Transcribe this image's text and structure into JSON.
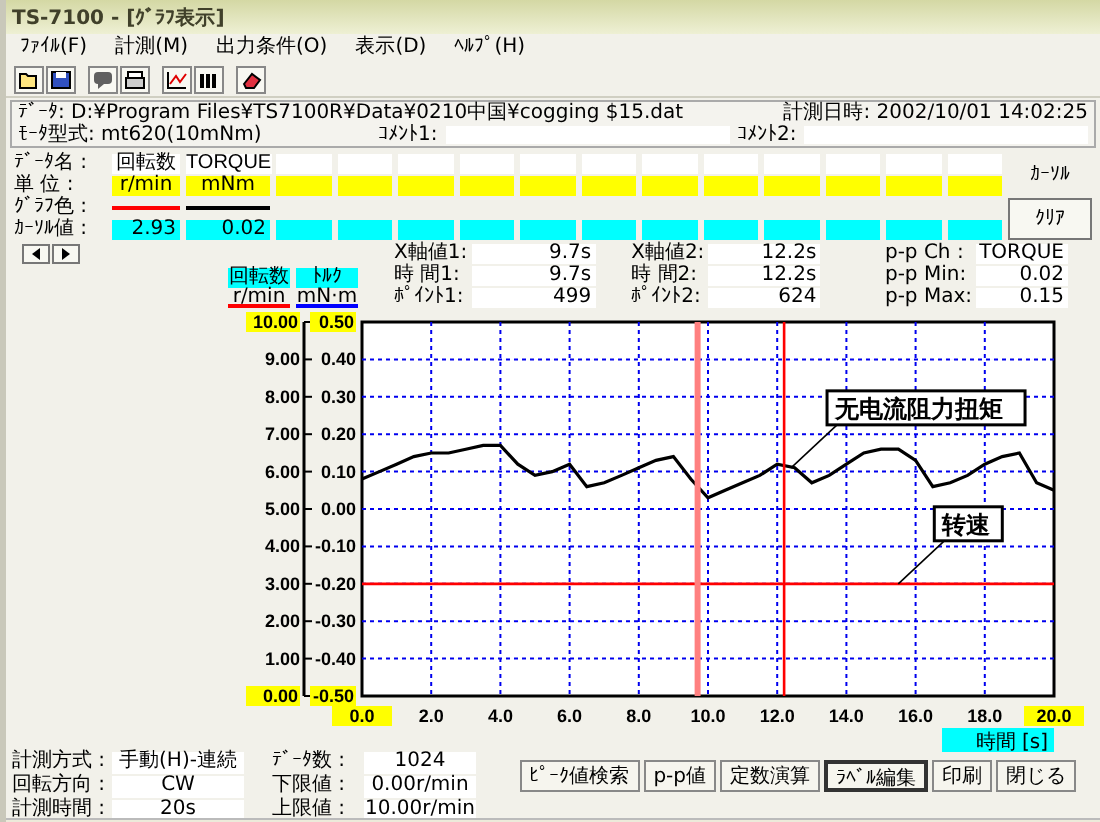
{
  "window": {
    "title": "TS-7100 - [ｸﾞﾗﾌ表示]"
  },
  "menu": [
    "ﾌｧｲﾙ(F)",
    "計測(M)",
    "出力条件(O)",
    "表示(D)",
    "ﾍﾙﾌﾟ(H)"
  ],
  "file_info": {
    "data_path": "ﾃﾞｰﾀ: D:¥Program Files¥TS7100R¥Data¥0210中国¥cogging $15.dat",
    "measured_at": "計測日時: 2002/10/01 14:02:25",
    "motor_type": "ﾓｰﾀ型式: mt620(10mNm)",
    "comment1_label": "ｺﾒﾝﾄ1:",
    "comment2_label": "ｺﾒﾝﾄ2:"
  },
  "channel_table": {
    "row_labels": [
      "ﾃﾞｰﾀ名 :",
      "単 位 :",
      "ｸﾞﾗﾌ色 :",
      "ｶｰｿﾙ値 :"
    ],
    "channels": [
      {
        "name": "回転数",
        "unit": "r/min",
        "color": "#ff0000",
        "cursor_value": "2.93"
      },
      {
        "name": "TORQUE",
        "unit": "mNm",
        "color": "#000000",
        "cursor_value": "0.02"
      }
    ],
    "cursor_label": "ｶｰｿﾙ",
    "clear_button": "ｸﾘｱ"
  },
  "cursor_info": {
    "cursor1": [
      {
        "label": "X軸値1:",
        "value": "9.7s"
      },
      {
        "label": "時 間1:",
        "value": "9.7s"
      },
      {
        "label": "ﾎﾟｲﾝﾄ1:",
        "value": "499"
      }
    ],
    "cursor2": [
      {
        "label": "X軸値2:",
        "value": "12.2s"
      },
      {
        "label": "時 間2:",
        "value": "12.2s"
      },
      {
        "label": "ﾎﾟｲﾝﾄ2:",
        "value": "624"
      }
    ],
    "peak_to_peak": [
      {
        "label": "p-p Ch :",
        "value": "TORQUE"
      },
      {
        "label": "p-p Min:",
        "value": "0.02"
      },
      {
        "label": "p-p Max:",
        "value": "0.15"
      }
    ]
  },
  "graph": {
    "axis_headers": [
      {
        "unit": "r/min",
        "color": "#ff0000"
      },
      {
        "unit": "mN·m",
        "color": "#0000ff"
      }
    ],
    "chart_data": {
      "type": "line",
      "xlabel": "時間 [s]",
      "grid": true,
      "ref_lines": [
        {
          "axis": "x",
          "value": 9.7,
          "color": "#ff8080"
        },
        {
          "axis": "x",
          "value": 12.2,
          "color": "#ff0000"
        }
      ],
      "xlim": [
        0,
        20
      ],
      "ylim": [
        0,
        10
      ],
      "y2lim": [
        -0.5,
        0.5
      ],
      "xticks": [
        {
          "value": 0,
          "label": "0.0"
        },
        {
          "value": 2,
          "label": "2.0"
        },
        {
          "value": 4,
          "label": "4.0"
        },
        {
          "value": 6,
          "label": "6.0"
        },
        {
          "value": 8,
          "label": "8.0"
        },
        {
          "value": 10,
          "label": "10.0"
        },
        {
          "value": 12,
          "label": "12.0"
        },
        {
          "value": 14,
          "label": "14.0"
        },
        {
          "value": 16,
          "label": "16.0"
        },
        {
          "value": 18,
          "label": "18.0"
        },
        {
          "value": 20,
          "label": "20.0"
        }
      ],
      "yticks": [
        {
          "value": 10,
          "label": "10.00"
        },
        {
          "value": 9,
          "label": "9.00"
        },
        {
          "value": 8,
          "label": "8.00"
        },
        {
          "value": 7,
          "label": "7.00"
        },
        {
          "value": 6,
          "label": "6.00"
        },
        {
          "value": 5,
          "label": "5.00"
        },
        {
          "value": 4,
          "label": "4.00"
        },
        {
          "value": 3,
          "label": "3.00"
        },
        {
          "value": 2,
          "label": "2.00"
        },
        {
          "value": 1,
          "label": "1.00"
        },
        {
          "value": 0,
          "label": "0.00"
        }
      ],
      "y2ticks": [
        {
          "value": 0.5,
          "label": "0.50"
        },
        {
          "value": 0.4,
          "label": "0.40"
        },
        {
          "value": 0.3,
          "label": "0.30"
        },
        {
          "value": 0.2,
          "label": "0.20"
        },
        {
          "value": 0.1,
          "label": "0.10"
        },
        {
          "value": 0,
          "label": "0.00"
        },
        {
          "value": -0.1,
          "label": "-0.10"
        },
        {
          "value": -0.2,
          "label": "-0.20"
        },
        {
          "value": -0.3,
          "label": "-0.30"
        },
        {
          "value": -0.4,
          "label": "-0.40"
        },
        {
          "value": -0.5,
          "label": "-0.50"
        }
      ],
      "x": [
        0,
        0.5,
        1,
        1.5,
        2,
        2.5,
        3,
        3.5,
        4,
        4.5,
        5,
        5.5,
        6,
        6.5,
        7,
        7.5,
        8,
        8.5,
        9,
        9.5,
        10,
        10.5,
        11,
        11.5,
        12,
        12.5,
        13,
        13.5,
        14,
        14.5,
        15,
        15.5,
        16,
        16.5,
        17,
        17.5,
        18,
        18.5,
        19,
        19.5,
        20
      ],
      "series": [
        {
          "name": "回転数",
          "color": "#ff0000",
          "values": [
            3,
            3,
            3,
            3,
            3,
            3,
            3,
            3,
            3,
            3,
            3,
            3,
            3,
            3,
            3,
            3,
            3,
            3,
            3,
            3,
            3,
            3,
            3,
            3,
            3,
            3,
            3,
            3,
            3,
            3,
            3,
            3,
            3,
            3,
            3,
            3,
            3,
            3,
            3,
            3,
            3
          ]
        },
        {
          "name": "ﾄﾙｸ",
          "color": "#000000",
          "axis": "y2",
          "values": [
            0.08,
            0.1,
            0.12,
            0.14,
            0.15,
            0.15,
            0.16,
            0.17,
            0.17,
            0.12,
            0.09,
            0.1,
            0.12,
            0.06,
            0.07,
            0.09,
            0.11,
            0.13,
            0.14,
            0.08,
            0.03,
            0.05,
            0.07,
            0.09,
            0.12,
            0.11,
            0.07,
            0.09,
            0.12,
            0.15,
            0.16,
            0.16,
            0.13,
            0.06,
            0.07,
            0.09,
            0.12,
            0.14,
            0.15,
            0.07,
            0.05
          ]
        }
      ],
      "annotations": [
        {
          "text": "无电流阻力扭矩",
          "x": 12.4,
          "y": 6.1
        },
        {
          "text": "转速",
          "x": 15.5,
          "y": 3
        }
      ]
    }
  },
  "measurement": {
    "left": [
      {
        "label": "計測方式 :",
        "value": "手動(H)-連続"
      },
      {
        "label": "回転方向 :",
        "value": "CW"
      },
      {
        "label": "計測時間 :",
        "value": "20s"
      }
    ],
    "right": [
      {
        "label": "ﾃﾞｰﾀ数 :",
        "value": "1024"
      },
      {
        "label": "下限値 :",
        "value": "0.00r/min"
      },
      {
        "label": "上限値 :",
        "value": "10.00r/min"
      }
    ]
  },
  "buttons": [
    {
      "label": "ﾋﾟｰｸ値検索",
      "focused": false
    },
    {
      "label": "p-p値",
      "focused": false
    },
    {
      "label": "定数演算",
      "focused": false
    },
    {
      "label": "ﾗﾍﾞﾙ編集",
      "focused": true
    },
    {
      "label": "印刷",
      "focused": false
    },
    {
      "label": "閉じる",
      "focused": false
    }
  ]
}
